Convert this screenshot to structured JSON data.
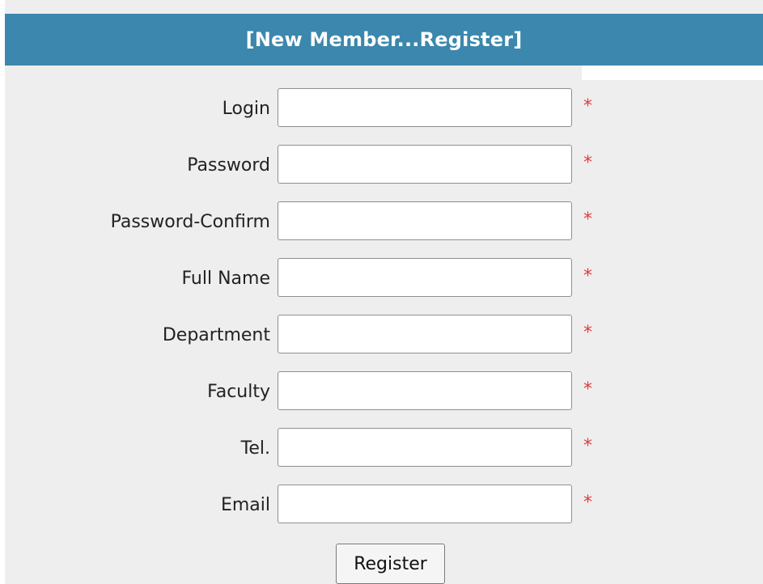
{
  "header": {
    "title": "[New Member...Register]"
  },
  "form": {
    "fields": [
      {
        "label": "Login",
        "value": "",
        "required_mark": "*"
      },
      {
        "label": "Password",
        "value": "",
        "required_mark": "*"
      },
      {
        "label": "Password-Confirm",
        "value": "",
        "required_mark": "*"
      },
      {
        "label": "Full Name",
        "value": "",
        "required_mark": "*"
      },
      {
        "label": "Department",
        "value": "",
        "required_mark": "*"
      },
      {
        "label": "Faculty",
        "value": "",
        "required_mark": "*"
      },
      {
        "label": "Tel.",
        "value": "",
        "required_mark": "*"
      },
      {
        "label": "Email",
        "value": "",
        "required_mark": "*"
      }
    ],
    "submit_label": "Register"
  },
  "colors": {
    "header_bg": "#3b87ad",
    "panel_bg": "#eeeeee",
    "required": "#e23b3b"
  }
}
